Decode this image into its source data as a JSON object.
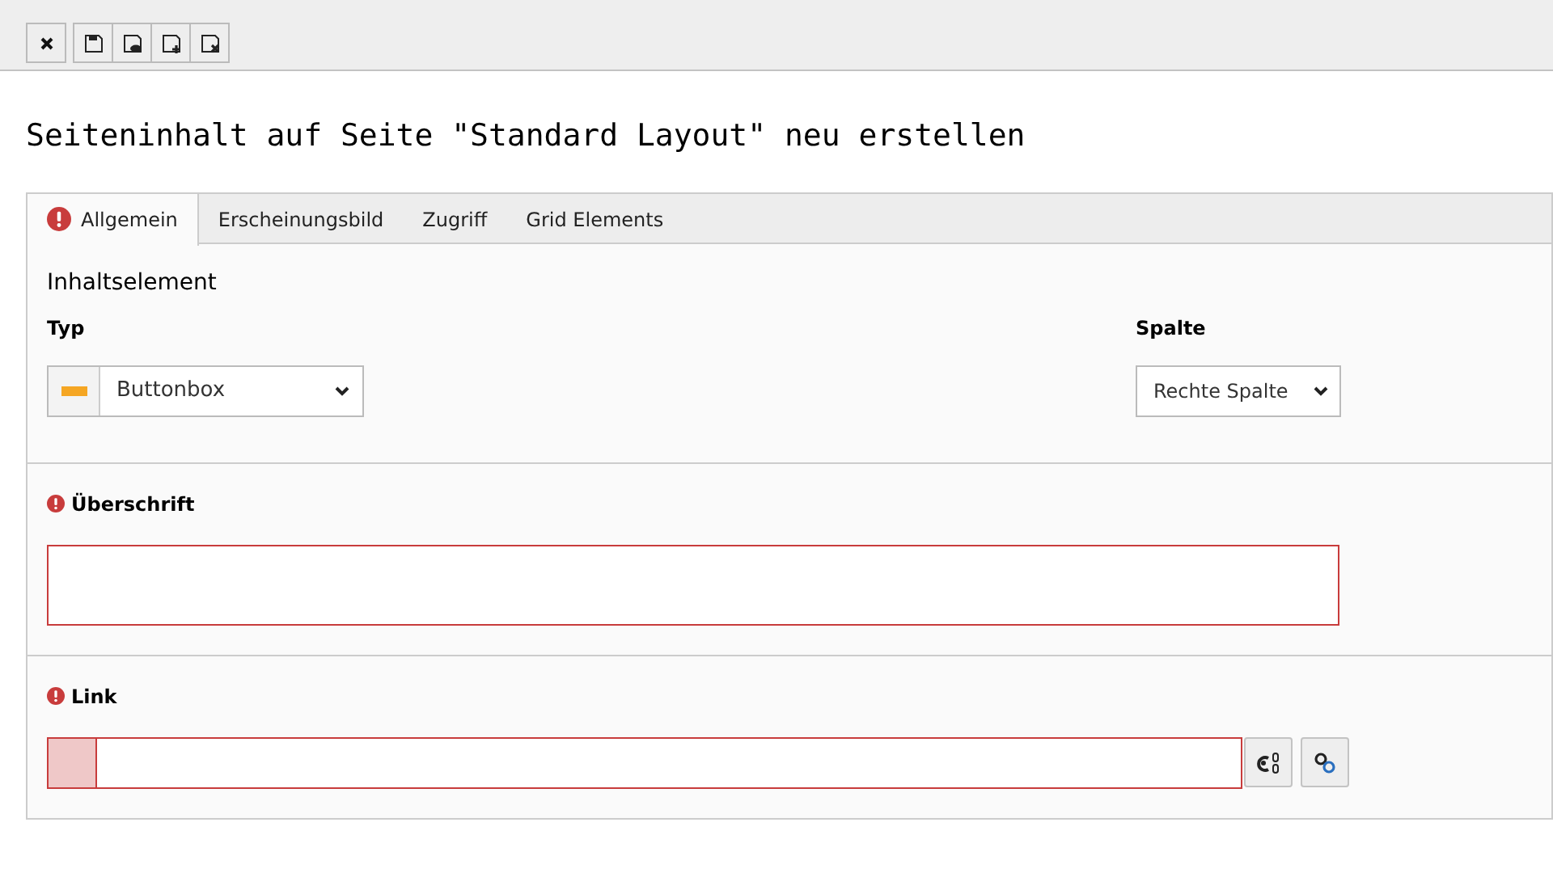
{
  "toolbar": {
    "buttons": [
      {
        "kind": "close"
      },
      {
        "kind": "save"
      },
      {
        "kind": "save-view"
      },
      {
        "kind": "save-new"
      },
      {
        "kind": "save-close"
      }
    ]
  },
  "title": "Seiteninhalt auf Seite \"Standard Layout\" neu erstellen",
  "tabs": [
    {
      "label": "Allgemein",
      "selected": true,
      "error": true
    },
    {
      "label": "Erscheinungsbild",
      "selected": false,
      "error": false
    },
    {
      "label": "Zugriff",
      "selected": false,
      "error": false
    },
    {
      "label": "Grid Elements",
      "selected": false,
      "error": false
    }
  ],
  "section": {
    "heading": "Inhaltselement",
    "typ": {
      "label": "Typ",
      "value": "Buttonbox"
    },
    "spalte": {
      "label": "Spalte",
      "value": "Rechte Spalte"
    }
  },
  "fields": [
    {
      "kind": "text",
      "label": "Überschrift",
      "error": true
    },
    {
      "kind": "link",
      "label": "Link",
      "error": true
    }
  ]
}
